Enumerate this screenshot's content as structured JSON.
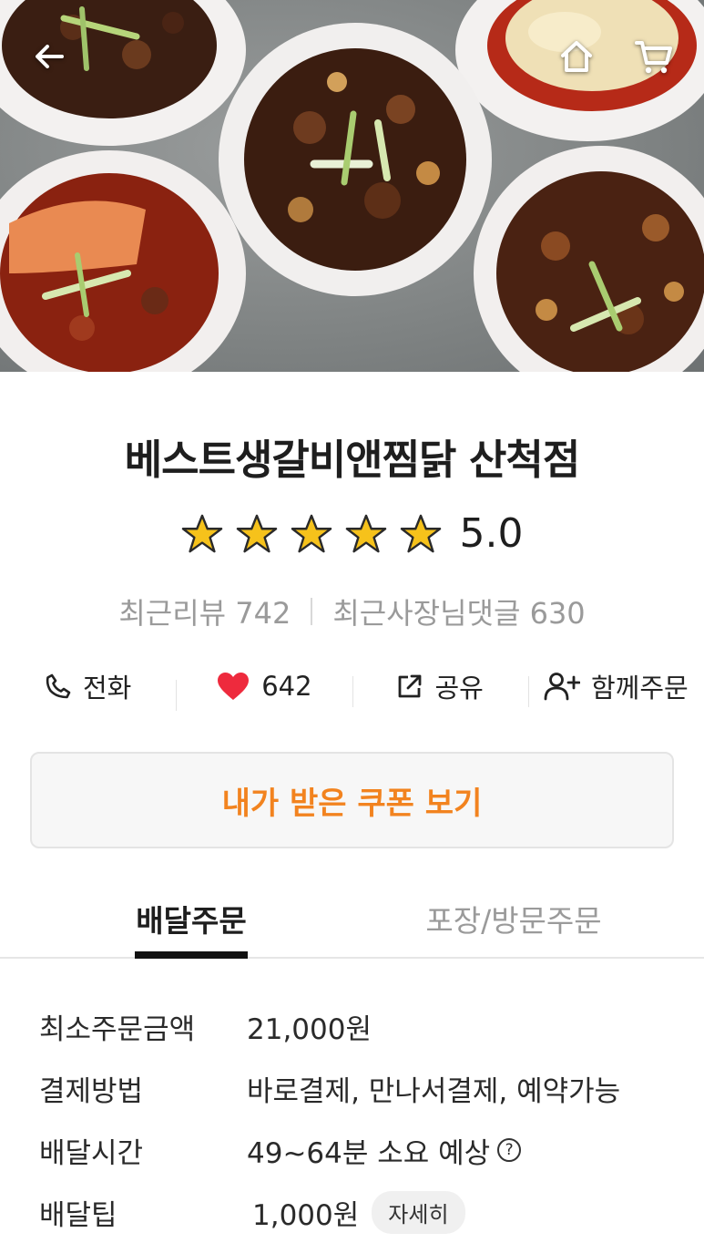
{
  "header": {
    "back_icon": "back-arrow-icon",
    "home_icon": "home-icon",
    "cart_icon": "cart-icon"
  },
  "store": {
    "name": "베스트생갈비앤찜닭 산척점",
    "rating": "5.0",
    "rating_stars": 5,
    "recent_reviews": "최근리뷰 742",
    "recent_owner_replies": "최근사장님댓글 630"
  },
  "actions": {
    "call": "전화",
    "likes": "642",
    "share": "공유",
    "group_order": "함께주문"
  },
  "coupon": {
    "label": "내가 받은 쿠폰 보기"
  },
  "tabs": {
    "delivery": "배달주문",
    "pickup": "포장/방문주문"
  },
  "info": {
    "min_order_label": "최소주문금액",
    "min_order_value": "21,000원",
    "payment_label": "결제방법",
    "payment_value": "바로결제, 만나서결제, 예약가능",
    "delivery_time_label": "배달시간",
    "delivery_time_value": "49~64분 소요 예상",
    "delivery_tip_label": "배달팁",
    "delivery_tip_value": "1,000원",
    "detail_button": "자세히"
  },
  "colors": {
    "accent_orange": "#f2831f",
    "heart_red": "#ee2a3d",
    "star_yellow": "#f6c21b"
  }
}
